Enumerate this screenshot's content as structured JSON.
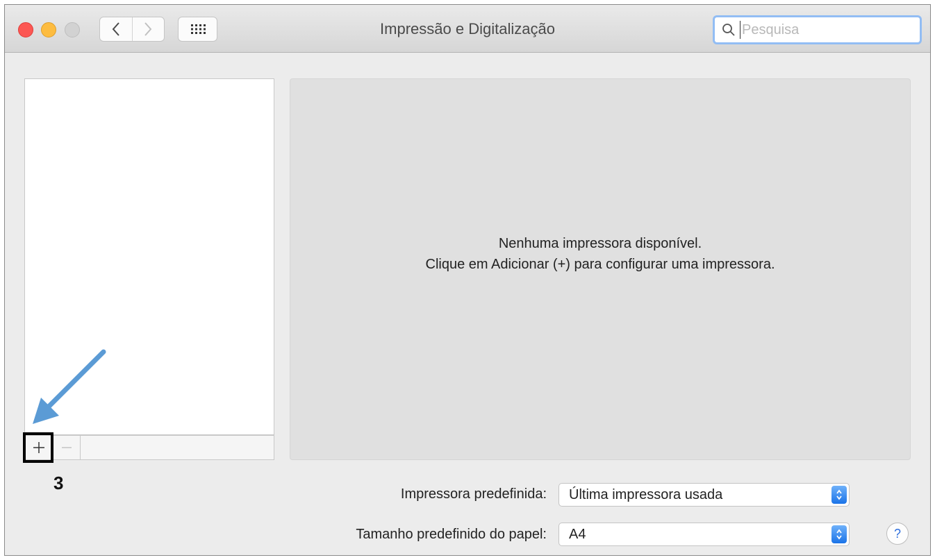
{
  "window": {
    "title": "Impressão e Digitalização",
    "search_placeholder": "Pesquisa"
  },
  "detail": {
    "message_line1": "Nenhuma impressora disponível.",
    "message_line2": "Clique em Adicionar (+) para configurar uma impressora."
  },
  "annotation": {
    "step_number": "3",
    "arrow_color": "#5b9bd5"
  },
  "settings": {
    "default_printer_label": "Impressora predefinida:",
    "default_printer_value": "Última impressora usada",
    "paper_size_label": "Tamanho predefinido do papel:",
    "paper_size_value": "A4"
  },
  "help": {
    "label": "?"
  },
  "colors": {
    "close": "#fc5753",
    "minimize": "#fdbc40",
    "zoom_disabled": "#d2d2d2",
    "accent": "#1a73e8"
  }
}
